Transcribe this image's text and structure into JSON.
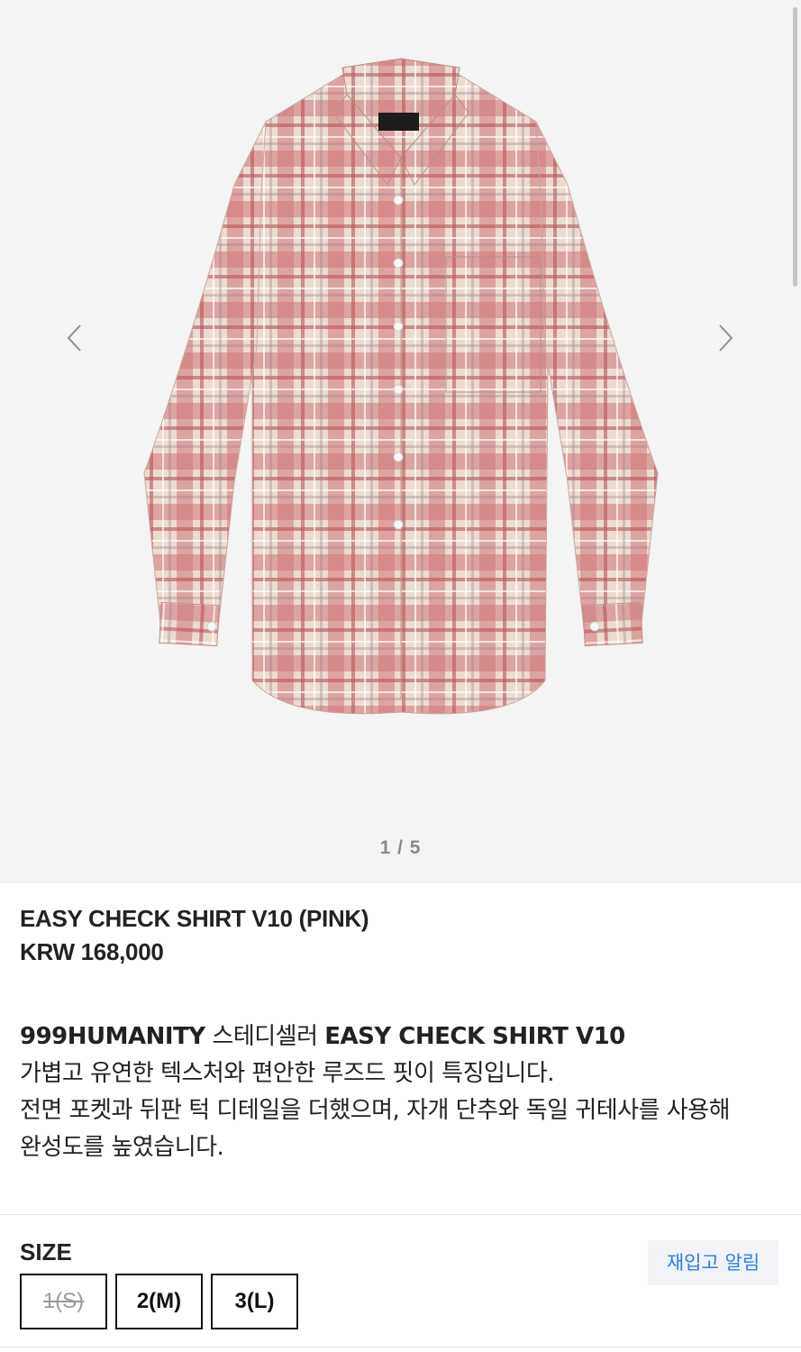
{
  "gallery": {
    "counter": "1 / 5",
    "image_alt": "EASY CHECK SHIRT V10 (PINK)",
    "background": "#f4f4f4"
  },
  "product": {
    "name": "EASY CHECK SHIRT V10 (PINK)",
    "price": "KRW 168,000"
  },
  "description": {
    "line1_brand": "999HUMANITY",
    "line1_mid": " 스테디셀러 ",
    "line1_title": "EASY CHECK SHIRT V10",
    "line2": "가볍고 유연한 텍스처와 편안한 루즈드 핏이 특징입니다.",
    "line3": "전면 포켓과 뒤판 턱 디테일을 더했으며, 자개 단추와 독일 귀테사를 사용해",
    "line4": "완성도를 높였습니다."
  },
  "size": {
    "label": "SIZE",
    "restock_label": "재입고 알림",
    "options": [
      {
        "label": "1(S)",
        "sold_out": true
      },
      {
        "label": "2(M)",
        "sold_out": false
      },
      {
        "label": "3(L)",
        "sold_out": false
      }
    ]
  },
  "colors": {
    "accent_link": "#2b7de9",
    "shirt_base": "#ecdcd0",
    "shirt_stripe": "#c9636a"
  },
  "icons": {
    "prev": "chevron-left-icon",
    "next": "chevron-right-icon"
  }
}
